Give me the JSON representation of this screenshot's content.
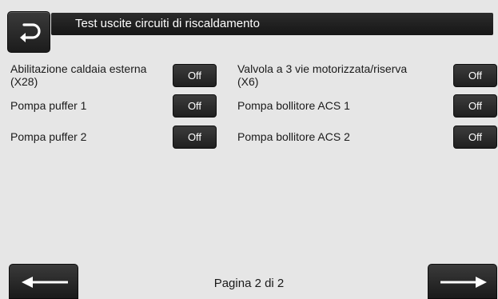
{
  "header": {
    "title": "Test uscite circuiti di riscaldamento"
  },
  "icons": {
    "back": "return-arrow-icon",
    "prev": "arrow-left-icon",
    "next": "arrow-right-icon"
  },
  "rows": [
    {
      "label_line1": "Abilitazione caldaia esterna",
      "label_line2": "(X28)",
      "value": "Off"
    },
    {
      "label_line1": "Pompa puffer 1",
      "label_line2": "",
      "value": "Off"
    },
    {
      "label_line1": "Pompa puffer 2",
      "label_line2": "",
      "value": "Off"
    },
    {
      "label_line1": "Valvola a 3 vie motorizzata/riserva",
      "label_line2": "(X6)",
      "value": "Off"
    },
    {
      "label_line1": "Pompa bollitore ACS 1",
      "label_line2": "",
      "value": "Off"
    },
    {
      "label_line1": "Pompa bollitore ACS 2",
      "label_line2": "",
      "value": "Off"
    }
  ],
  "footer": {
    "page_label": "Pagina 2 di 2"
  }
}
